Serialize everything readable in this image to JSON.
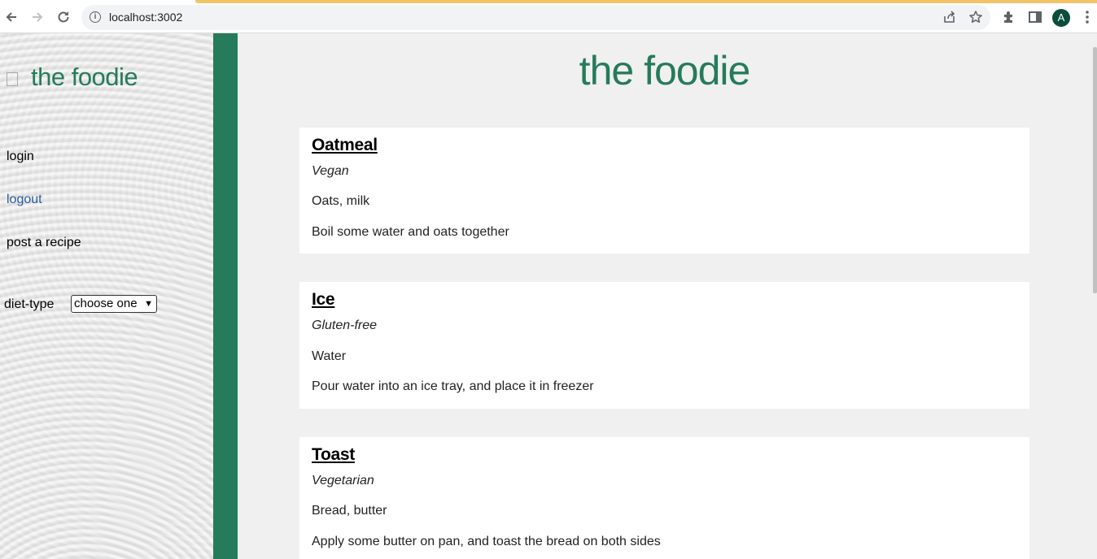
{
  "browser": {
    "url": "localhost:3002",
    "profile_initial": "A",
    "load_bar_color": "#f1c46a"
  },
  "sidebar": {
    "title": "the foodie",
    "links": [
      "login",
      "logout",
      "post a recipe"
    ],
    "diet_label": "diet-type",
    "diet_selected": "choose one"
  },
  "main": {
    "title": "the foodie",
    "recipes": [
      {
        "name": "Oatmeal",
        "diet": "Vegan",
        "ingredients": "Oats, milk",
        "instructions": "Boil some water and oats together"
      },
      {
        "name": "Ice",
        "diet": "Gluten-free",
        "ingredients": "Water",
        "instructions": "Pour water into an ice tray, and place it in freezer"
      },
      {
        "name": "Toast",
        "diet": "Vegetarian",
        "ingredients": "Bread, butter",
        "instructions": "Apply some butter on pan, and toast the bread on both sides"
      }
    ]
  },
  "colors": {
    "brand": "#267b5a",
    "link": "#2c5aa0"
  }
}
